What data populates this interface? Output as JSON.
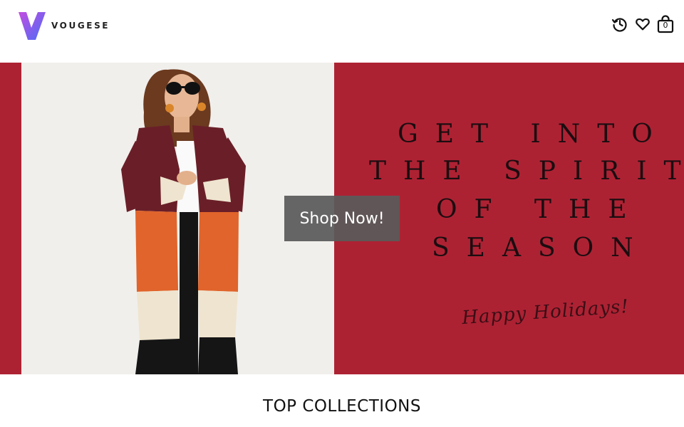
{
  "brand": {
    "name": "VOUGESE",
    "gradient_from": "#c44de0",
    "gradient_to": "#4a6cf7"
  },
  "header": {
    "icons": [
      "history-icon",
      "heart-icon",
      "shopping-bag-icon"
    ],
    "cart_count": "0"
  },
  "hero": {
    "background_color": "#ad2233",
    "headline_lines": [
      "GET INTO",
      "THE SPIRIT",
      "OF THE",
      "SEASON"
    ],
    "script_text": "Happy Holidays!",
    "cta_label": "Shop Now!"
  },
  "sections": {
    "top_collections_title": "TOP COLLECTIONS"
  }
}
